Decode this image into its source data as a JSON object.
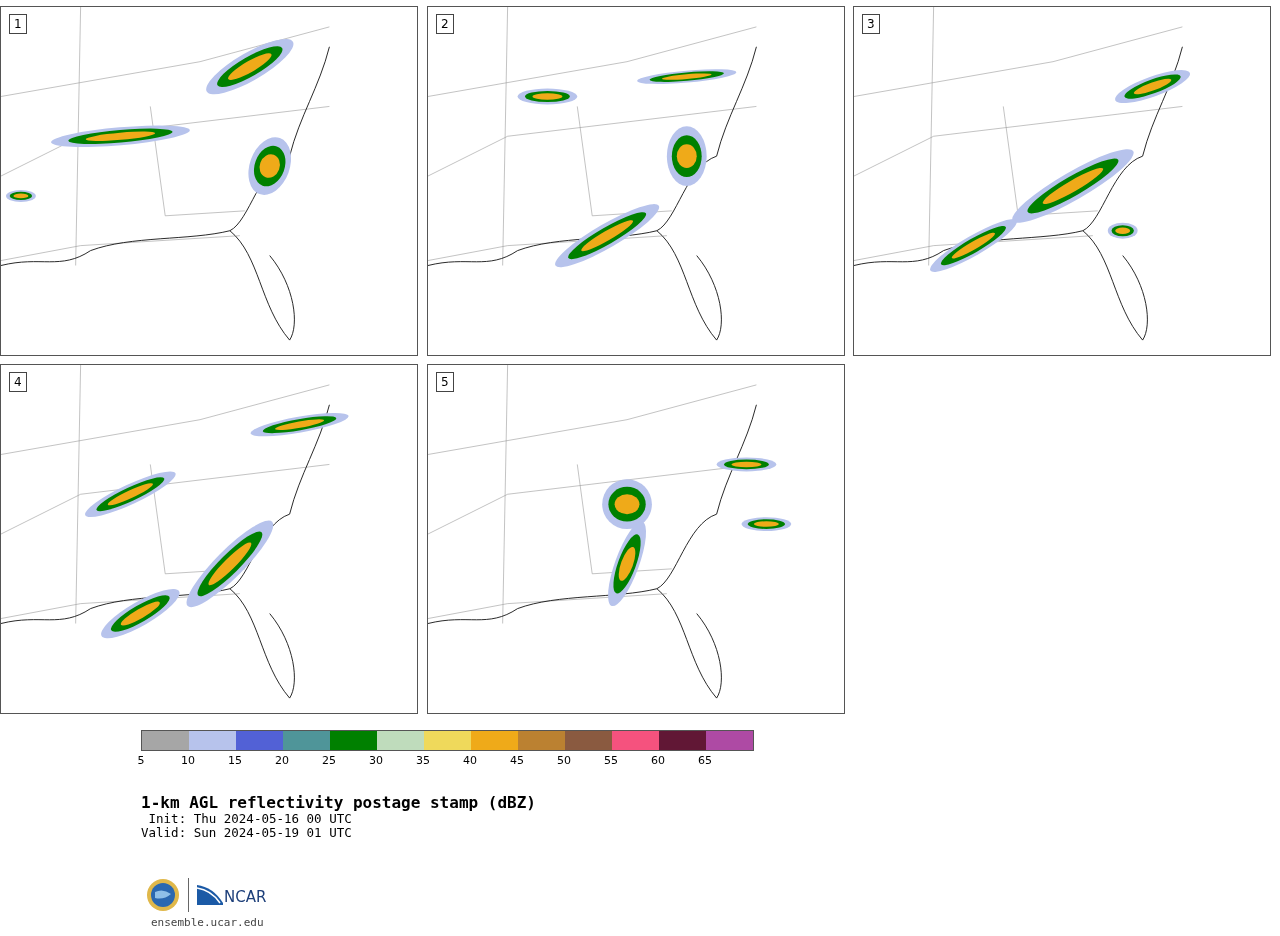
{
  "panels": [
    {
      "number": "1"
    },
    {
      "number": "2"
    },
    {
      "number": "3"
    },
    {
      "number": "4"
    },
    {
      "number": "5"
    }
  ],
  "colorbar": {
    "bins": [
      {
        "label": "5",
        "color": "#a6a6a6"
      },
      {
        "label": "10",
        "color": "#b7c3ec"
      },
      {
        "label": "15",
        "color": "#5261d6"
      },
      {
        "label": "20",
        "color": "#4f9599"
      },
      {
        "label": "25",
        "color": "#008000"
      },
      {
        "label": "30",
        "color": "#bfdcbc"
      },
      {
        "label": "35",
        "color": "#efd95b"
      },
      {
        "label": "40",
        "color": "#efaa19"
      },
      {
        "label": "45",
        "color": "#bb8131"
      },
      {
        "label": "50",
        "color": "#8a5a40"
      },
      {
        "label": "55",
        "color": "#f5527e"
      },
      {
        "label": "60",
        "color": "#611735"
      },
      {
        "label": "65",
        "color": "#ae4aa4"
      }
    ]
  },
  "title": "1-km AGL reflectivity postage stamp (dBZ)",
  "init": " Init: Thu 2024-05-16 00 UTC",
  "valid": "Valid: Sun 2024-05-19 01 UTC",
  "footer": {
    "logo_text": "NCAR",
    "url": "ensemble.ucar.edu"
  }
}
